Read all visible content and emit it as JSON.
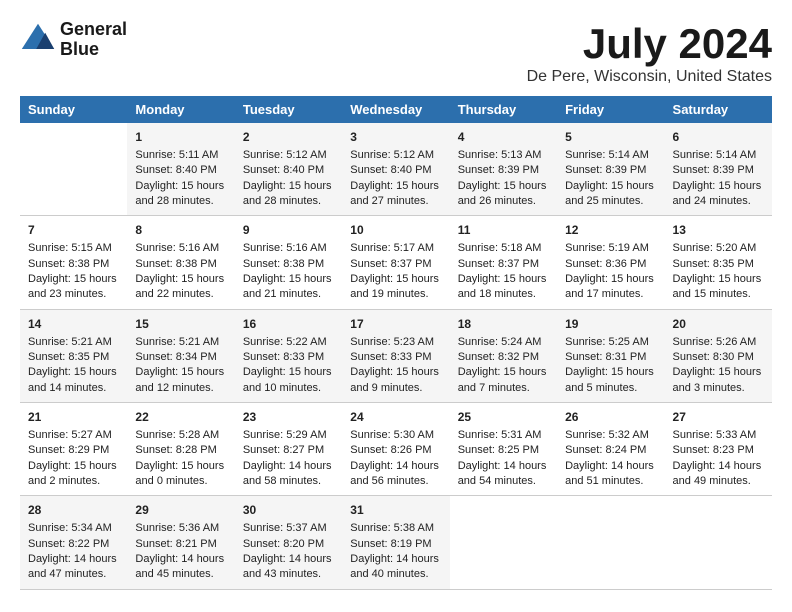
{
  "logo": {
    "line1": "General",
    "line2": "Blue"
  },
  "title": "July 2024",
  "subtitle": "De Pere, Wisconsin, United States",
  "days_header": [
    "Sunday",
    "Monday",
    "Tuesday",
    "Wednesday",
    "Thursday",
    "Friday",
    "Saturday"
  ],
  "weeks": [
    [
      {
        "num": "",
        "content": ""
      },
      {
        "num": "1",
        "content": "Sunrise: 5:11 AM\nSunset: 8:40 PM\nDaylight: 15 hours\nand 28 minutes."
      },
      {
        "num": "2",
        "content": "Sunrise: 5:12 AM\nSunset: 8:40 PM\nDaylight: 15 hours\nand 28 minutes."
      },
      {
        "num": "3",
        "content": "Sunrise: 5:12 AM\nSunset: 8:40 PM\nDaylight: 15 hours\nand 27 minutes."
      },
      {
        "num": "4",
        "content": "Sunrise: 5:13 AM\nSunset: 8:39 PM\nDaylight: 15 hours\nand 26 minutes."
      },
      {
        "num": "5",
        "content": "Sunrise: 5:14 AM\nSunset: 8:39 PM\nDaylight: 15 hours\nand 25 minutes."
      },
      {
        "num": "6",
        "content": "Sunrise: 5:14 AM\nSunset: 8:39 PM\nDaylight: 15 hours\nand 24 minutes."
      }
    ],
    [
      {
        "num": "7",
        "content": "Sunrise: 5:15 AM\nSunset: 8:38 PM\nDaylight: 15 hours\nand 23 minutes."
      },
      {
        "num": "8",
        "content": "Sunrise: 5:16 AM\nSunset: 8:38 PM\nDaylight: 15 hours\nand 22 minutes."
      },
      {
        "num": "9",
        "content": "Sunrise: 5:16 AM\nSunset: 8:38 PM\nDaylight: 15 hours\nand 21 minutes."
      },
      {
        "num": "10",
        "content": "Sunrise: 5:17 AM\nSunset: 8:37 PM\nDaylight: 15 hours\nand 19 minutes."
      },
      {
        "num": "11",
        "content": "Sunrise: 5:18 AM\nSunset: 8:37 PM\nDaylight: 15 hours\nand 18 minutes."
      },
      {
        "num": "12",
        "content": "Sunrise: 5:19 AM\nSunset: 8:36 PM\nDaylight: 15 hours\nand 17 minutes."
      },
      {
        "num": "13",
        "content": "Sunrise: 5:20 AM\nSunset: 8:35 PM\nDaylight: 15 hours\nand 15 minutes."
      }
    ],
    [
      {
        "num": "14",
        "content": "Sunrise: 5:21 AM\nSunset: 8:35 PM\nDaylight: 15 hours\nand 14 minutes."
      },
      {
        "num": "15",
        "content": "Sunrise: 5:21 AM\nSunset: 8:34 PM\nDaylight: 15 hours\nand 12 minutes."
      },
      {
        "num": "16",
        "content": "Sunrise: 5:22 AM\nSunset: 8:33 PM\nDaylight: 15 hours\nand 10 minutes."
      },
      {
        "num": "17",
        "content": "Sunrise: 5:23 AM\nSunset: 8:33 PM\nDaylight: 15 hours\nand 9 minutes."
      },
      {
        "num": "18",
        "content": "Sunrise: 5:24 AM\nSunset: 8:32 PM\nDaylight: 15 hours\nand 7 minutes."
      },
      {
        "num": "19",
        "content": "Sunrise: 5:25 AM\nSunset: 8:31 PM\nDaylight: 15 hours\nand 5 minutes."
      },
      {
        "num": "20",
        "content": "Sunrise: 5:26 AM\nSunset: 8:30 PM\nDaylight: 15 hours\nand 3 minutes."
      }
    ],
    [
      {
        "num": "21",
        "content": "Sunrise: 5:27 AM\nSunset: 8:29 PM\nDaylight: 15 hours\nand 2 minutes."
      },
      {
        "num": "22",
        "content": "Sunrise: 5:28 AM\nSunset: 8:28 PM\nDaylight: 15 hours\nand 0 minutes."
      },
      {
        "num": "23",
        "content": "Sunrise: 5:29 AM\nSunset: 8:27 PM\nDaylight: 14 hours\nand 58 minutes."
      },
      {
        "num": "24",
        "content": "Sunrise: 5:30 AM\nSunset: 8:26 PM\nDaylight: 14 hours\nand 56 minutes."
      },
      {
        "num": "25",
        "content": "Sunrise: 5:31 AM\nSunset: 8:25 PM\nDaylight: 14 hours\nand 54 minutes."
      },
      {
        "num": "26",
        "content": "Sunrise: 5:32 AM\nSunset: 8:24 PM\nDaylight: 14 hours\nand 51 minutes."
      },
      {
        "num": "27",
        "content": "Sunrise: 5:33 AM\nSunset: 8:23 PM\nDaylight: 14 hours\nand 49 minutes."
      }
    ],
    [
      {
        "num": "28",
        "content": "Sunrise: 5:34 AM\nSunset: 8:22 PM\nDaylight: 14 hours\nand 47 minutes."
      },
      {
        "num": "29",
        "content": "Sunrise: 5:36 AM\nSunset: 8:21 PM\nDaylight: 14 hours\nand 45 minutes."
      },
      {
        "num": "30",
        "content": "Sunrise: 5:37 AM\nSunset: 8:20 PM\nDaylight: 14 hours\nand 43 minutes."
      },
      {
        "num": "31",
        "content": "Sunrise: 5:38 AM\nSunset: 8:19 PM\nDaylight: 14 hours\nand 40 minutes."
      },
      {
        "num": "",
        "content": ""
      },
      {
        "num": "",
        "content": ""
      },
      {
        "num": "",
        "content": ""
      }
    ]
  ]
}
